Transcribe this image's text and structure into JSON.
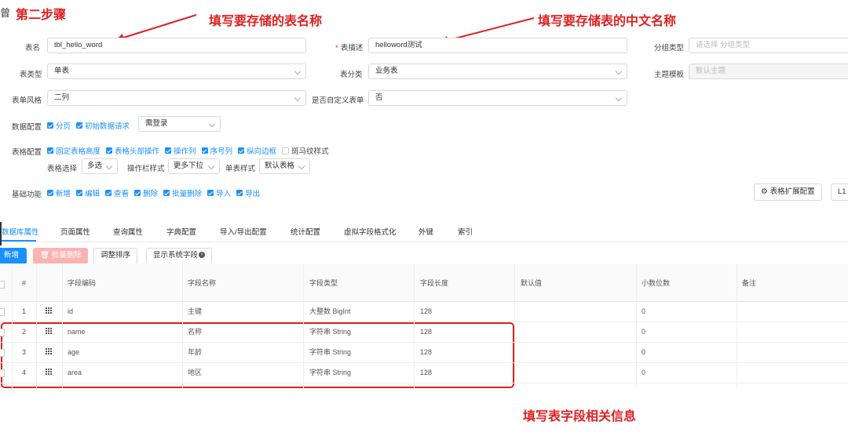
{
  "annotations": {
    "step": "第二步骤",
    "table_name_hint": "填写要存储的表名称",
    "table_cn_name_hint": "填写要存储表的中文名称",
    "field_hint": "填写表字段相关信息"
  },
  "form": {
    "table_name": {
      "label": "表名",
      "value": "tbl_hello_word"
    },
    "table_desc": {
      "label": "表描述",
      "value": "helloword测试"
    },
    "group_type": {
      "label": "分组类型",
      "placeholder": "请选择 分组类型"
    },
    "table_type": {
      "label": "表类型",
      "value": "单表"
    },
    "table_category": {
      "label": "表分类",
      "value": "业务表"
    },
    "theme_template": {
      "label": "主题模板",
      "value": "默认主题"
    },
    "form_style": {
      "label": "表单风格",
      "value": "二列"
    },
    "custom_form": {
      "label": "是否自定义表单",
      "value": "否"
    }
  },
  "data_config": {
    "label": "数据配置",
    "options": [
      {
        "label": "分页",
        "checked": true
      },
      {
        "label": "初始数据请求",
        "checked": true
      }
    ],
    "select": "需登录"
  },
  "table_config": {
    "label": "表格配置",
    "options": [
      {
        "label": "固定表格高度",
        "checked": true
      },
      {
        "label": "表格头部操作",
        "checked": true
      },
      {
        "label": "操作列",
        "checked": true
      },
      {
        "label": "序号列",
        "checked": true
      },
      {
        "label": "纵向边框",
        "checked": true
      },
      {
        "label": "斑马纹样式",
        "checked": false
      }
    ],
    "table_select": {
      "label": "表格选择",
      "value": "多选"
    },
    "op_bar_style": {
      "label": "操作栏样式",
      "value": "更多下拉"
    },
    "form_style": {
      "label": "单表样式",
      "value": "默认表格"
    }
  },
  "base_functions": {
    "label": "基础功能",
    "options": [
      {
        "label": "新增",
        "checked": true
      },
      {
        "label": "编辑",
        "checked": true
      },
      {
        "label": "查看",
        "checked": true
      },
      {
        "label": "删除",
        "checked": true
      },
      {
        "label": "批量删除",
        "checked": true
      },
      {
        "label": "导入",
        "checked": true
      },
      {
        "label": "导出",
        "checked": true
      }
    ],
    "ext_config_button": "表格扩展配置",
    "extra_button": "L1"
  },
  "tabs": [
    "数据库属性",
    "页面属性",
    "查询属性",
    "字典配置",
    "导入/导出配置",
    "统计配置",
    "虚拟字段格式化",
    "外键",
    "索引"
  ],
  "toolbar": {
    "add": "新增",
    "batch_delete": "批量删除",
    "sort": "调整排序",
    "show_system": "显示系统字段"
  },
  "columns": [
    "#",
    "字段编码",
    "字段名称",
    "字段类型",
    "字段长度",
    "默认值",
    "小数位数",
    "备注"
  ],
  "rows": [
    {
      "idx": "1",
      "code": "id",
      "name": "主键",
      "type": "大整数 BigInt",
      "len": "128",
      "default": "",
      "decimal": "0",
      "remark": ""
    },
    {
      "idx": "2",
      "code": "name",
      "name": "名称",
      "type": "字符串 String",
      "len": "128",
      "default": "",
      "decimal": "0",
      "remark": ""
    },
    {
      "idx": "3",
      "code": "age",
      "name": "年龄",
      "type": "字符串 String",
      "len": "128",
      "default": "",
      "decimal": "0",
      "remark": ""
    },
    {
      "idx": "4",
      "code": "area",
      "name": "地区",
      "type": "字符串 String",
      "len": "128",
      "default": "",
      "decimal": "0",
      "remark": ""
    }
  ],
  "colors": {
    "accent": "#1890ff",
    "annotation": "#e02020",
    "danger": "#f5222d"
  }
}
